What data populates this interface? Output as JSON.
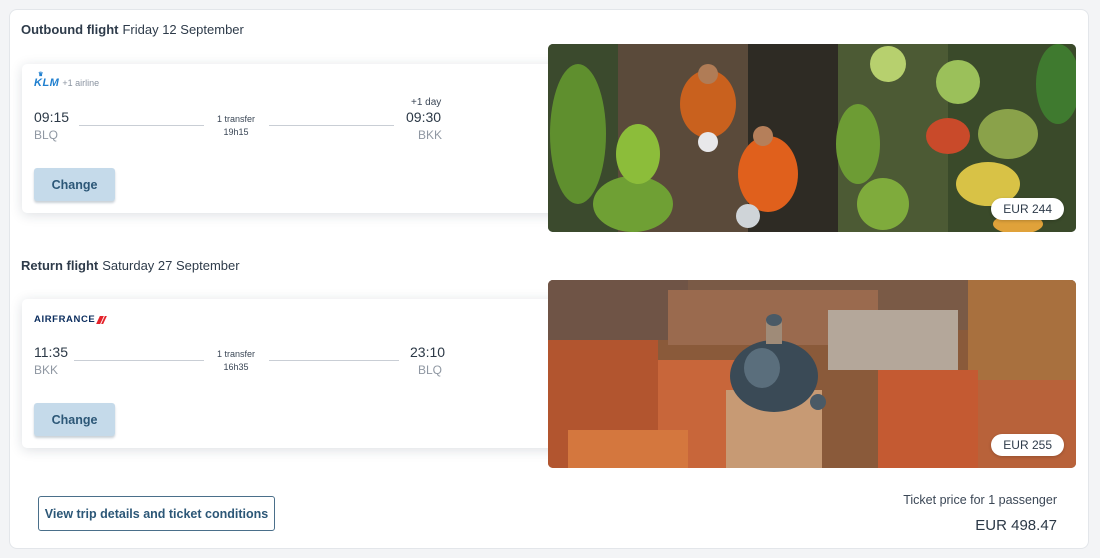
{
  "outbound": {
    "title": "Outbound flight",
    "date": "Friday 12 September",
    "airline_logo": "KLM",
    "airline_extra": "+1 airline",
    "depart_time": "09:15",
    "depart_code": "BLQ",
    "transfer": "1 transfer",
    "duration": "19h15",
    "plus_day": "+1 day",
    "arrive_time": "09:30",
    "arrive_code": "BKK",
    "change_label": "Change",
    "price": "EUR 244",
    "image": "floating-market-photo"
  },
  "return": {
    "title": "Return flight",
    "date": "Saturday 27 September",
    "airline_logo": "AIRFRANCE",
    "depart_time": "11:35",
    "depart_code": "BKK",
    "transfer": "1 transfer",
    "duration": "16h35",
    "arrive_time": "23:10",
    "arrive_code": "BLQ",
    "change_label": "Change",
    "price": "EUR 255",
    "image": "bologna-rooftops-photo"
  },
  "footer": {
    "details_button": "View trip details and ticket conditions",
    "ticket_label": "Ticket price for 1 passenger",
    "ticket_total": "EUR 498.47"
  }
}
